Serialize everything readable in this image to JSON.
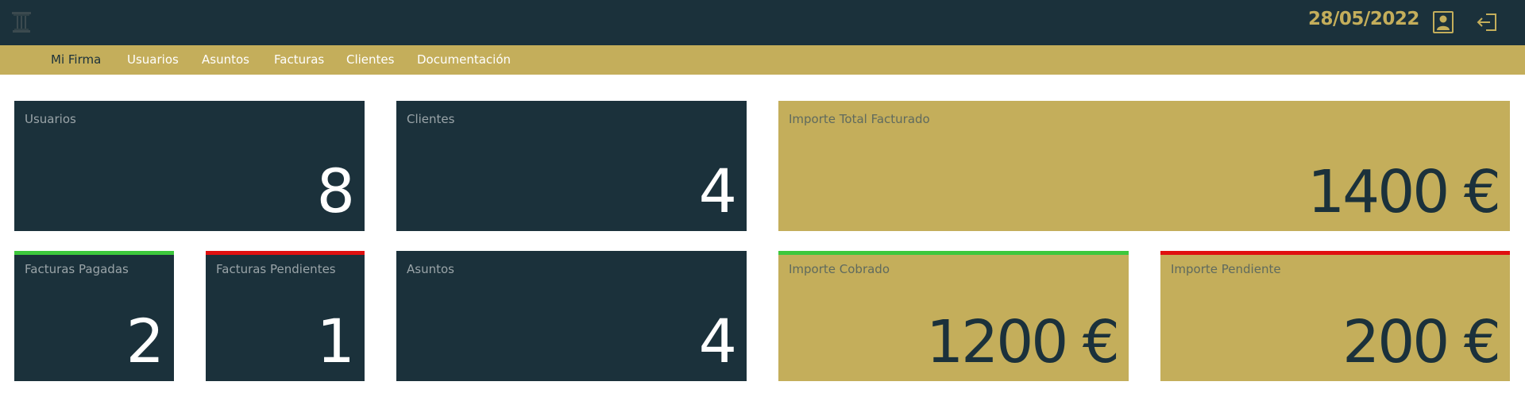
{
  "header": {
    "date": "28/05/2022",
    "logo_icon": "column-logo-icon",
    "user_icon": "user-profile-icon",
    "logout_icon": "logout-icon"
  },
  "nav": {
    "items": [
      {
        "label": "Mi Firma",
        "active": true
      },
      {
        "label": "Usuarios",
        "active": false
      },
      {
        "label": "Asuntos",
        "active": false
      },
      {
        "label": "Facturas",
        "active": false
      },
      {
        "label": "Clientes",
        "active": false
      },
      {
        "label": "Documentación",
        "active": false
      }
    ]
  },
  "stats": {
    "usuarios": {
      "label": "Usuarios",
      "value": "8"
    },
    "clientes": {
      "label": "Clientes",
      "value": "4"
    },
    "importe_total": {
      "label": "Importe Total Facturado",
      "value": "1400 €"
    },
    "facturas_pagadas": {
      "label": "Facturas Pagadas",
      "value": "2"
    },
    "facturas_pendientes": {
      "label": "Facturas Pendientes",
      "value": "1"
    },
    "asuntos": {
      "label": "Asuntos",
      "value": "4"
    },
    "importe_cobrado": {
      "label": "Importe Cobrado",
      "value": "1200 €"
    },
    "importe_pendiente": {
      "label": "Importe Pendiente",
      "value": "200 €"
    }
  },
  "colors": {
    "dark": "#1b313b",
    "gold": "#c4ae5b",
    "success_accent": "#3dc83d",
    "danger_accent": "#e01010"
  }
}
